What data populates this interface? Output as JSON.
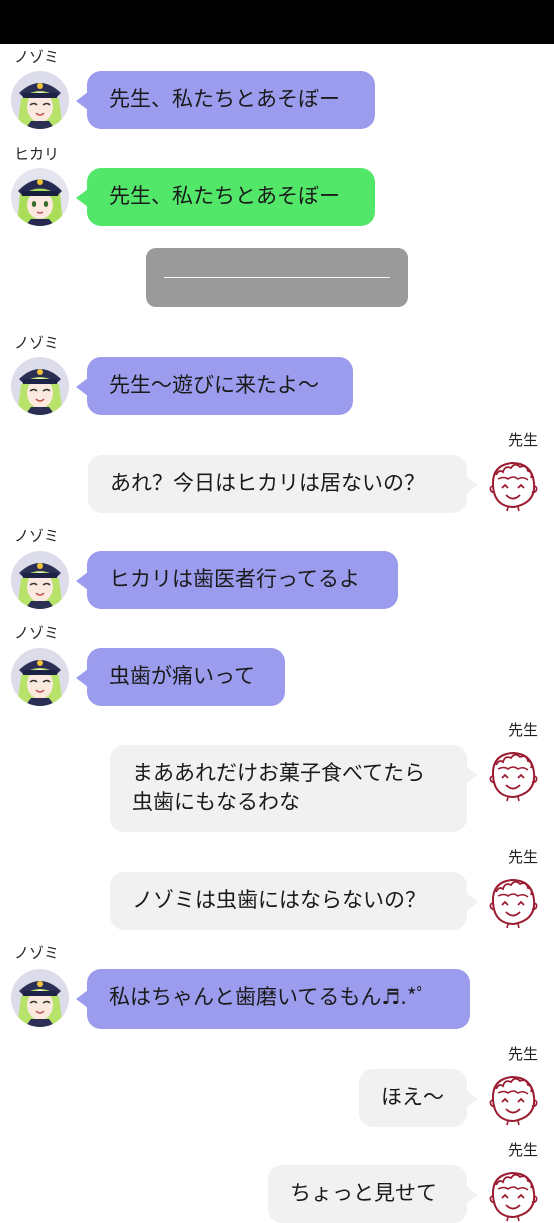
{
  "colors": {
    "nozomi_bubble": "#9c9cef",
    "hikari_bubble": "#53e76a",
    "sensei_bubble": "#f1f1f1",
    "divider_box": "#9a9a9a",
    "status_bar": "#000000"
  },
  "icons": {
    "nozomi_avatar": "nozomi-avatar-icon",
    "hikari_avatar": "hikari-avatar-icon",
    "sensei_avatar": "sensei-face-sketch-icon"
  },
  "messages": [
    {
      "speaker": "ノゾミ",
      "text": "先生、私たちとあそぼー"
    },
    {
      "speaker": "ヒカリ",
      "text": "先生、私たちとあそぼー"
    },
    {
      "speaker": "ノゾミ",
      "text": "先生〜遊びに来たよ〜"
    },
    {
      "speaker": "先生",
      "text": "あれ？今日はヒカリは居ないの？"
    },
    {
      "speaker": "ノゾミ",
      "text": "ヒカリは歯医者行ってるよ"
    },
    {
      "speaker": "ノゾミ",
      "text": "虫歯が痛いって"
    },
    {
      "speaker": "先生",
      "text": "まああれだけお菓子食べてたら\n虫歯にもなるわな"
    },
    {
      "speaker": "先生",
      "text": "ノゾミは虫歯にはならないの？"
    },
    {
      "speaker": "ノゾミ",
      "text": "私はちゃんと歯磨いてるもん♬.*ﾟ"
    },
    {
      "speaker": "先生",
      "text": "ほえ〜"
    },
    {
      "speaker": "先生",
      "text": "ちょっと見せて"
    }
  ]
}
